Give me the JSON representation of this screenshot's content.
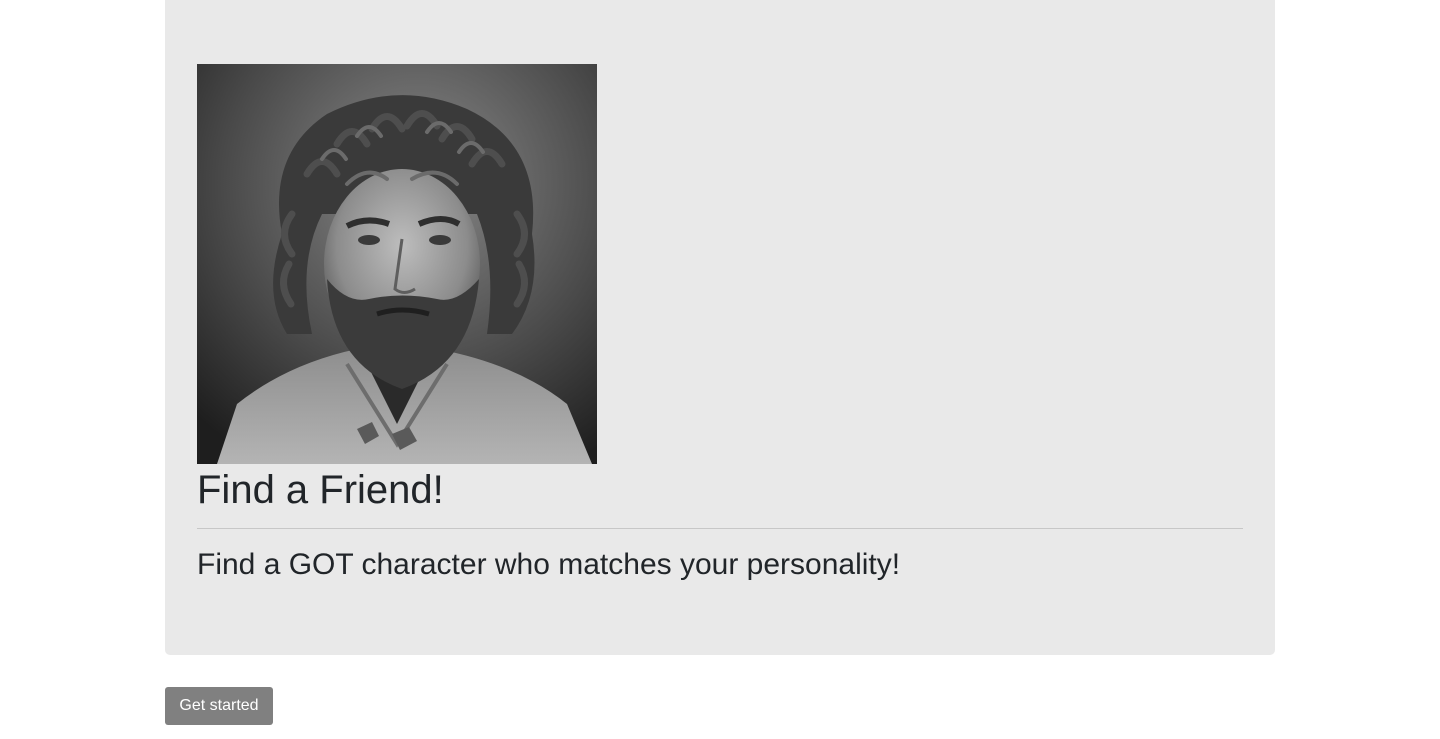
{
  "hero": {
    "image": {
      "description": "Black and white portrait photo",
      "icon": "portrait-photo"
    },
    "title": "Find a Friend!",
    "subtitle": "Find a GOT character who matches your personality!"
  },
  "actions": {
    "get_started_label": "Get started"
  },
  "colors": {
    "jumbotron_bg": "#e9e9e9",
    "button_bg": "#808080",
    "button_text": "#ffffff",
    "text": "#212529"
  }
}
